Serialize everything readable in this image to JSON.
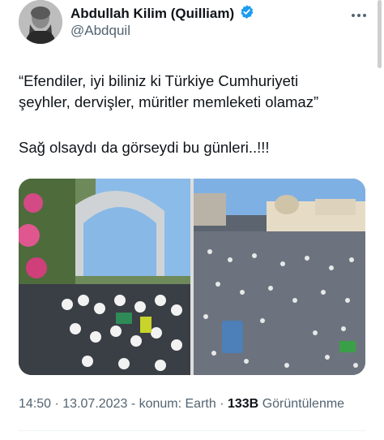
{
  "author": {
    "name": "Abdullah Kilim (Quilliam)",
    "handle": "@Abdquil",
    "verified_icon": "verified-badge-icon",
    "accent": "#1d9bf0"
  },
  "tweet": {
    "line1": "“Efendiler, iyi biliniz ki Türkiye Cumhuriyeti",
    "line2": "şeyhler, dervişler, müritler memleketi olamaz”",
    "line3": "Sağ olsaydı da görseydi bu günleri..!!!"
  },
  "media": {
    "photos": [
      "funeral-crowd-photo",
      "mosque-courtyard-crowd-photo"
    ]
  },
  "meta": {
    "time": "14:50",
    "date": "13.07.2023",
    "location": "konum: Earth",
    "views_count": "133B",
    "views_label": "Görüntülenme"
  }
}
